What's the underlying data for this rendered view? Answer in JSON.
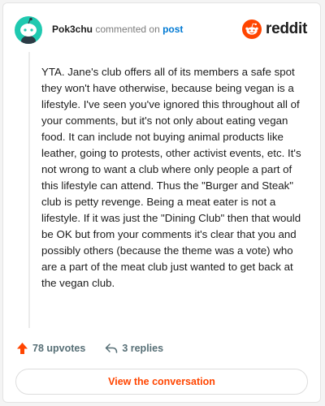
{
  "colors": {
    "avatar": "#1fc9b0",
    "reddit_orange": "#ff4500",
    "link_blue": "#0079d3",
    "upvote_orange": "#ff4500"
  },
  "header": {
    "username": "Pok3chu",
    "action_text": "commented on",
    "post_link": "post"
  },
  "brand": {
    "icon": "reddit-alien-icon",
    "wordmark": "reddit"
  },
  "comment": {
    "body": "YTA. Jane's club offers all of its members a safe spot they won't have otherwise, because being vegan is a lifestyle. I've seen you've ignored this throughout all of your comments, but it's not only about eating vegan food. It can include not buying animal products like leather, going to protests, other activist events, etc. It's not wrong to want a club where only people a part of this lifestyle can attend. Thus the \"Burger and Steak\" club is petty revenge. Being a meat eater is not a lifestyle. If it was just the \"Dining Club\" then that would be OK but from your comments it's clear that you and possibly others (because the theme was a vote) who are a part of the meat club just wanted to get back at the vegan club."
  },
  "actions": {
    "upvotes": "78 upvotes",
    "upvote_icon": "upvote-arrow-icon",
    "replies": "3 replies",
    "reply_icon": "reply-arrow-icon"
  },
  "cta": {
    "label": "View the conversation"
  }
}
